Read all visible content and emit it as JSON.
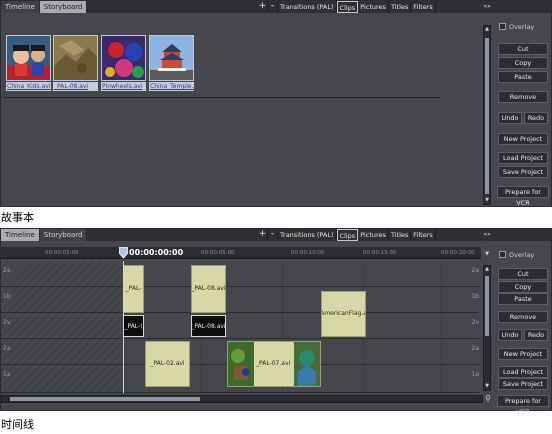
{
  "storyboard_panel": {
    "tabs": [
      {
        "label": "Timeline"
      },
      {
        "label": "Storyboard"
      }
    ],
    "library_tabs": [
      {
        "label": "Transitions (PAL)"
      },
      {
        "label": "Clips"
      },
      {
        "label": "Pictures"
      },
      {
        "label": "Titles"
      },
      {
        "label": "Filters"
      }
    ],
    "plus": "+",
    "minus": "-",
    "arrows": "«»",
    "clips": [
      {
        "label": "China_Kids.avi"
      },
      {
        "label": "_PAL-08.avi"
      },
      {
        "label": "Pinwheels.avi"
      },
      {
        "label": "China_Temple.a"
      }
    ],
    "buttons": {
      "overlay": "Overlay",
      "cut": "Cut",
      "copy": "Copy",
      "paste": "Paste",
      "remove": "Remove",
      "undo": "Undo",
      "redo": "Redo",
      "new_project": "New Project",
      "load_project": "Load Project",
      "save_project": "Save Project",
      "prepare_vcr": "Prepare for VCR"
    }
  },
  "caption_storyboard": "故事本",
  "timeline_panel": {
    "tabs": [
      {
        "label": "Timeline"
      },
      {
        "label": "Storyboard"
      }
    ],
    "library_tabs": [
      {
        "label": "Transitions (PAL)"
      },
      {
        "label": "Clips"
      },
      {
        "label": "Pictures"
      },
      {
        "label": "Titles"
      },
      {
        "label": "Filters"
      }
    ],
    "plus": "+",
    "minus": "-",
    "arrows": "«»",
    "timecode": "00:00:00:00",
    "ruler_ticks": [
      "00:00:05:00",
      "00:00:05:00",
      "00:00:10:00",
      "00:00:15:00",
      "00:00:20:00"
    ],
    "track_labels": [
      "2a",
      "1b",
      "2v",
      "2a",
      "1a"
    ],
    "clips": {
      "pal1_a": "_PAL-",
      "pal8_a": "_PAL-08.avi",
      "pal1_b": "_PAL-(",
      "pal8_b": "_PAL-08.avi",
      "american": "AmericanFlag.a",
      "pal02": "_PAL-02.avi",
      "pal07": "_PAL-07.avi"
    },
    "buttons": {
      "overlay": "Overlay",
      "cut": "Cut",
      "copy": "Copy",
      "paste": "Paste",
      "remove": "Remove",
      "undo": "Undo",
      "redo": "Redo",
      "new_project": "New Project",
      "load_project": "Load Project",
      "save_project": "Save Project",
      "prepare_vcr": "Prepare for VCR"
    }
  },
  "caption_timeline": "时间线",
  "icons": {
    "zoom": "magnifier-icon",
    "playhead": "playhead-marker-icon"
  }
}
